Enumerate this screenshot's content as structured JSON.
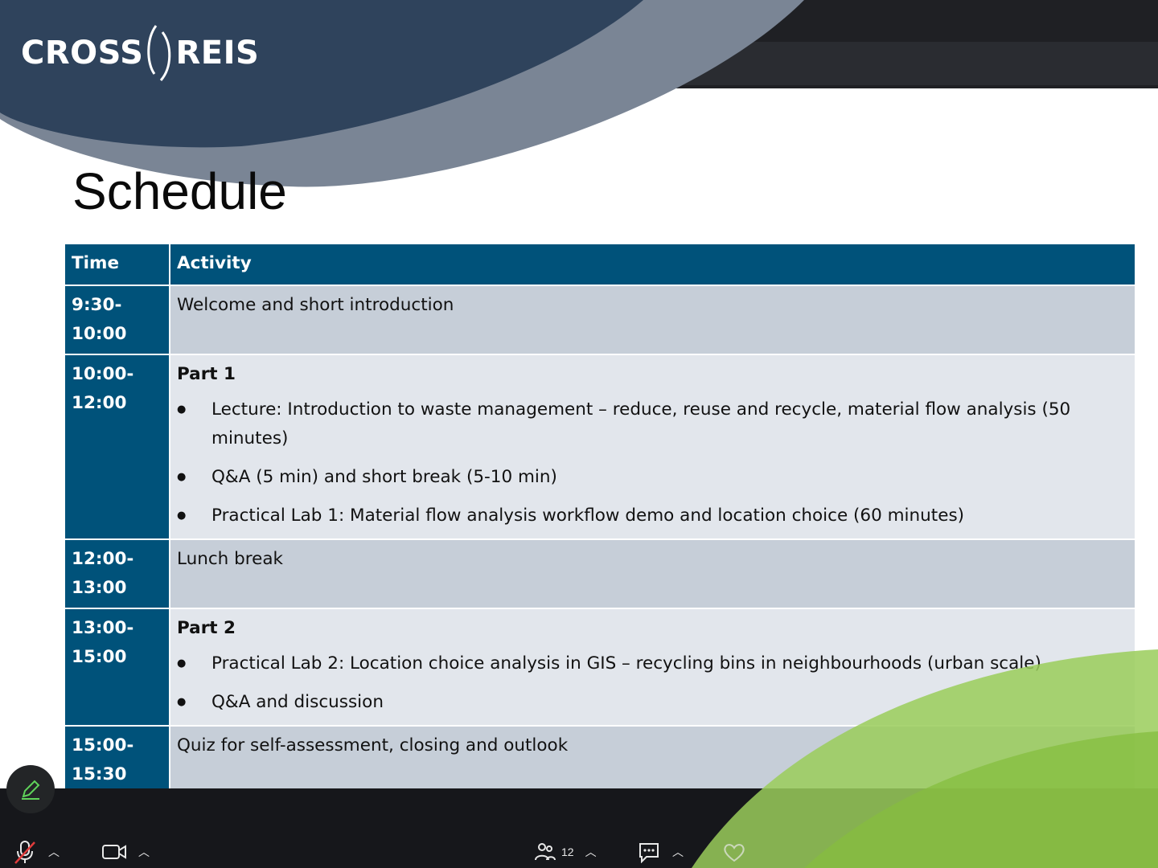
{
  "logo": {
    "left": "CROSS",
    "right": "REIS"
  },
  "title": "Schedule",
  "table": {
    "headers": {
      "time": "Time",
      "activity": "Activity"
    },
    "rows": [
      {
        "time_start": "9:30-",
        "time_end": "10:00",
        "activity": "Welcome and short introduction"
      },
      {
        "time_start": "10:00-",
        "time_end": "12:00",
        "part": "Part 1",
        "items": [
          "Lecture: Introduction to waste management – reduce, reuse and recycle, material flow analysis (50 minutes)",
          "Q&A (5 min) and short break (5-10 min)",
          "Practical Lab 1: Material flow analysis workflow demo and location choice (60 minutes)"
        ]
      },
      {
        "time_start": "12:00-",
        "time_end": "13:00",
        "activity": "Lunch break"
      },
      {
        "time_start": "13:00-",
        "time_end": "15:00",
        "part": "Part 2",
        "items": [
          "Practical Lab 2: Location choice analysis in GIS – recycling bins in neighbourhoods (urban scale)",
          "Q&A and discussion"
        ]
      },
      {
        "time_start": "15:00-",
        "time_end": "15:30",
        "activity": "Quiz for self-assessment, closing and outlook"
      }
    ]
  },
  "toolbar": {
    "participants_count": "12",
    "icons": [
      "pencil-icon",
      "mic-muted-icon",
      "camera-icon",
      "participants-icon",
      "chat-icon",
      "reaction-icon"
    ]
  },
  "colors": {
    "header_blue": "#00527a",
    "row_dark": "#c6ced8",
    "row_light": "#e2e6ec",
    "navy": "#2b3d55",
    "green": "#8fc24a",
    "pencil_green": "#5fd35a",
    "mute_red": "#e03c3c"
  }
}
